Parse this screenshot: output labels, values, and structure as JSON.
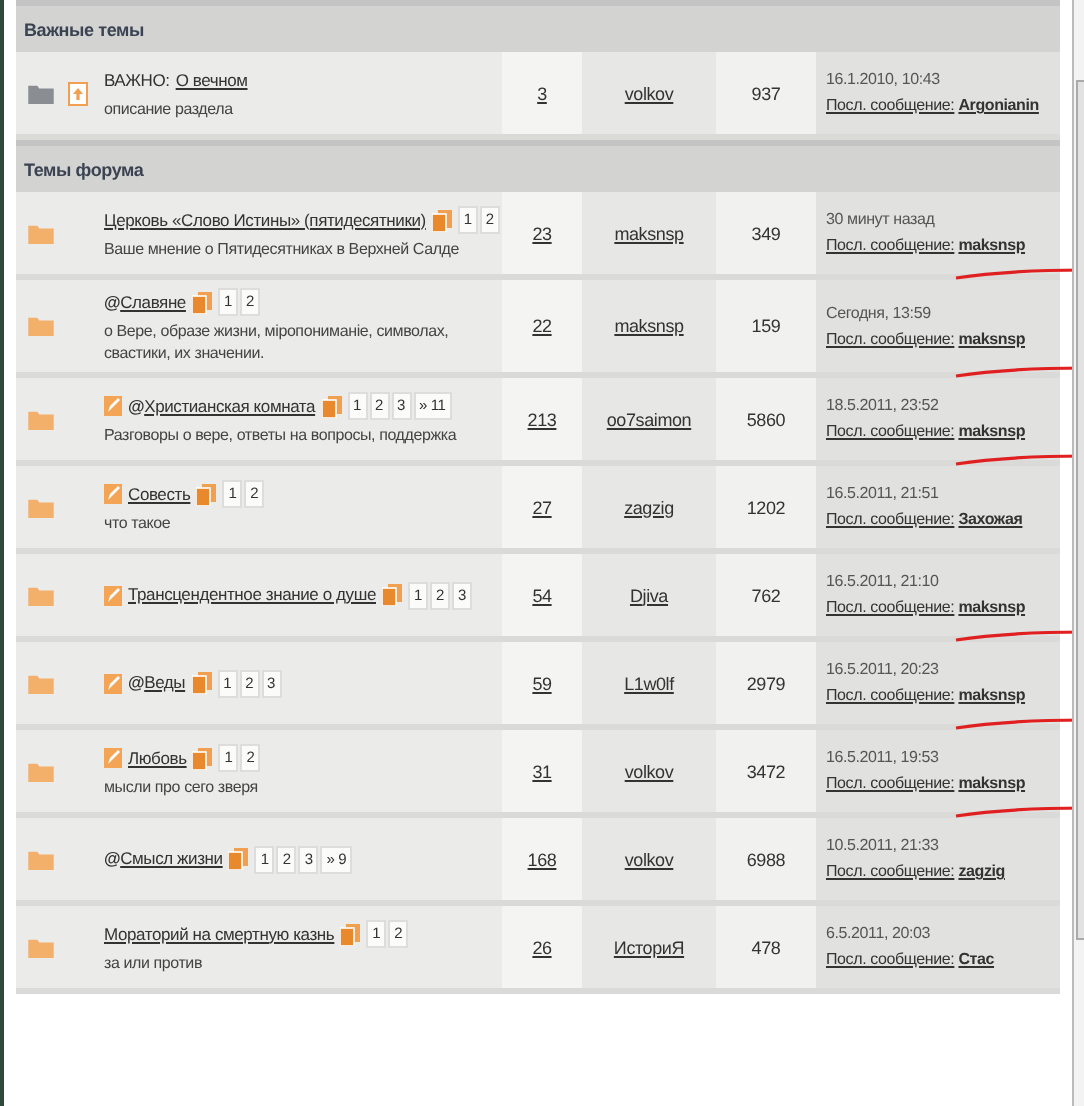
{
  "sections": [
    {
      "title": "Важные темы",
      "topics": [
        {
          "kind": "important",
          "announce": true,
          "new_post": false,
          "label": "ВАЖНО:",
          "title": "О вечном",
          "description": "описание раздела",
          "replies": "3",
          "author": "volkov",
          "views": "937",
          "last_time": "16.1.2010, 10:43",
          "last_label": "Посл. сообщение:",
          "last_user": "Argonianin",
          "marked": false
        }
      ]
    },
    {
      "title": "Темы форума",
      "topics": [
        {
          "kind": "normal",
          "announce": false,
          "new_post": false,
          "title": "Церковь «Слово Истины» (пятидесятники)",
          "pages": [
            "1",
            "2"
          ],
          "description": "Ваше мнение о Пятидесятниках в Верхней Салде",
          "replies": "23",
          "author": "maksnsp",
          "views": "349",
          "last_time": "30 минут назад",
          "last_label": "Посл. сообщение:",
          "last_user": "maksnsp",
          "marked": true
        },
        {
          "kind": "normal",
          "announce": false,
          "new_post": false,
          "prefix": "@",
          "title": "Славяне",
          "pages": [
            "1",
            "2"
          ],
          "description": "о Вере, образе жизни, міропониманіе, символах, свастики, их значении.",
          "replies": "22",
          "author": "maksnsp",
          "views": "159",
          "last_time": "Сегодня, 13:59",
          "last_label": "Посл. сообщение:",
          "last_user": "maksnsp",
          "marked": true
        },
        {
          "kind": "normal",
          "announce": false,
          "new_post": true,
          "prefix": "@",
          "title": "Христианская комната",
          "pages": [
            "1",
            "2",
            "3",
            "» 11"
          ],
          "description": "Разговоры о вере, ответы на вопросы, поддержка",
          "replies": "213",
          "author": "oo7saimon",
          "views": "5860",
          "last_time": "18.5.2011, 23:52",
          "last_label": "Посл. сообщение:",
          "last_user": "maksnsp",
          "marked": true
        },
        {
          "kind": "normal",
          "announce": false,
          "new_post": true,
          "title": "Совесть",
          "pages": [
            "1",
            "2"
          ],
          "description": "что такое",
          "replies": "27",
          "author": "zagzig",
          "views": "1202",
          "last_time": "16.5.2011, 21:51",
          "last_label": "Посл. сообщение:",
          "last_user": "Захожая",
          "marked": false
        },
        {
          "kind": "normal",
          "announce": false,
          "new_post": true,
          "title": "Трансцендентное знание о душе",
          "pages": [
            "1",
            "2",
            "3"
          ],
          "replies": "54",
          "author": "Djiva",
          "views": "762",
          "last_time": "16.5.2011, 21:10",
          "last_label": "Посл. сообщение:",
          "last_user": "maksnsp",
          "marked": true
        },
        {
          "kind": "normal",
          "announce": false,
          "new_post": true,
          "prefix": "@",
          "title": "Веды",
          "pages": [
            "1",
            "2",
            "3"
          ],
          "replies": "59",
          "author": "L1w0lf",
          "views": "2979",
          "last_time": "16.5.2011, 20:23",
          "last_label": "Посл. сообщение:",
          "last_user": "maksnsp",
          "marked": true
        },
        {
          "kind": "normal",
          "announce": false,
          "new_post": true,
          "title": "Любовь",
          "pages": [
            "1",
            "2"
          ],
          "description": "мысли про сего зверя",
          "replies": "31",
          "author": "volkov",
          "views": "3472",
          "last_time": "16.5.2011, 19:53",
          "last_label": "Посл. сообщение:",
          "last_user": "maksnsp",
          "marked": true
        },
        {
          "kind": "normal",
          "announce": false,
          "new_post": false,
          "prefix": "@",
          "title": "Смысл жизни",
          "pages": [
            "1",
            "2",
            "3",
            "» 9"
          ],
          "replies": "168",
          "author": "volkov",
          "views": "6988",
          "last_time": "10.5.2011, 21:33",
          "last_label": "Посл. сообщение:",
          "last_user": "zagzig",
          "marked": false
        },
        {
          "kind": "normal",
          "announce": false,
          "new_post": false,
          "title": "Мораторий на смертную казнь",
          "pages": [
            "1",
            "2"
          ],
          "description": "за или против",
          "replies": "26",
          "author": "ИсториЯ",
          "views": "478",
          "last_time": "6.5.2011, 20:03",
          "last_label": "Посл. сообщение:",
          "last_user": "Стас",
          "marked": false
        }
      ]
    }
  ]
}
